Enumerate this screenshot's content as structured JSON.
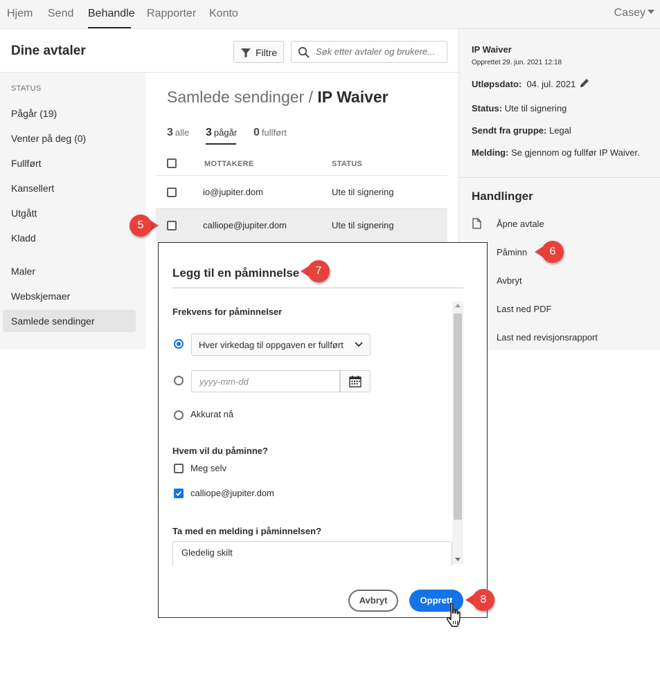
{
  "topnav": {
    "items": [
      "Hjem",
      "Send",
      "Behandle",
      "Rapporter",
      "Konto"
    ],
    "user": "Casey"
  },
  "header": {
    "title": "Dine avtaler",
    "filter_label": "Filtre",
    "search_placeholder": "Søk etter avtaler og brukere..."
  },
  "sidebar": {
    "status_label": "STATUS",
    "status_items": [
      "Pågår (19)",
      "Venter på deg (0)",
      "Fullført",
      "Kansellert",
      "Utgått",
      "Kladd"
    ],
    "other_items": [
      "Maler",
      "Webskjemaer",
      "Samlede sendinger"
    ]
  },
  "main": {
    "breadcrumb_prefix": "Samlede sendinger / ",
    "breadcrumb_current": "IP Waiver",
    "tabs": [
      {
        "count": "3",
        "label": "alle"
      },
      {
        "count": "3",
        "label": "pågår"
      },
      {
        "count": "0",
        "label": "fullført"
      }
    ],
    "columns": [
      "MOTTAKERE",
      "STATUS"
    ],
    "rows": [
      {
        "recipient": "io@jupiter.dom",
        "status": "Ute til signering"
      },
      {
        "recipient": "calliope@jupiter.dom",
        "status": "Ute til signering"
      }
    ]
  },
  "details": {
    "name": "IP Waiver",
    "created": "Opprettet 29. jun. 2021 12:18",
    "expiry_label": "Utløpsdato:",
    "expiry_value": "04. jul. 2021",
    "status_label": "Status:",
    "status_value": "Ute til signering",
    "group_label": "Sendt fra gruppe:",
    "group_value": "Legal",
    "message_label": "Melding:",
    "message_value": "Se gjennom og fullfør IP Waiver.",
    "actions_heading": "Handlinger",
    "actions": [
      "Åpne avtale",
      "Påminn",
      "Avbryt",
      "Last ned PDF",
      "Last ned revisjonsrapport"
    ]
  },
  "modal": {
    "title": "Legg til en påminnelse",
    "frequency_label": "Frekvens for påminnelser",
    "frequency_selected": "Hver virkedag til oppgaven er fullført",
    "date_placeholder": "yyyy-mm-dd",
    "now_option": "Akkurat nå",
    "who_label": "Hvem vil du påminne?",
    "who_options": [
      "Meg selv",
      "calliope@jupiter.dom"
    ],
    "message_label": "Ta med en melding i påminnelsen?",
    "message_value": "Gledelig skilt",
    "cancel_label": "Avbryt",
    "create_label": "Opprett"
  },
  "callouts": [
    "5",
    "6",
    "7",
    "8"
  ],
  "colors": {
    "accent": "#1473e6",
    "callout": "#e8413b",
    "panel_bg": "#f5f5f5"
  },
  "icons": [
    "filter-icon",
    "search-icon",
    "edit-pencil-icon",
    "document-icon",
    "chevron-down-icon",
    "calendar-icon",
    "checkmark-icon",
    "hand-cursor-icon"
  ]
}
